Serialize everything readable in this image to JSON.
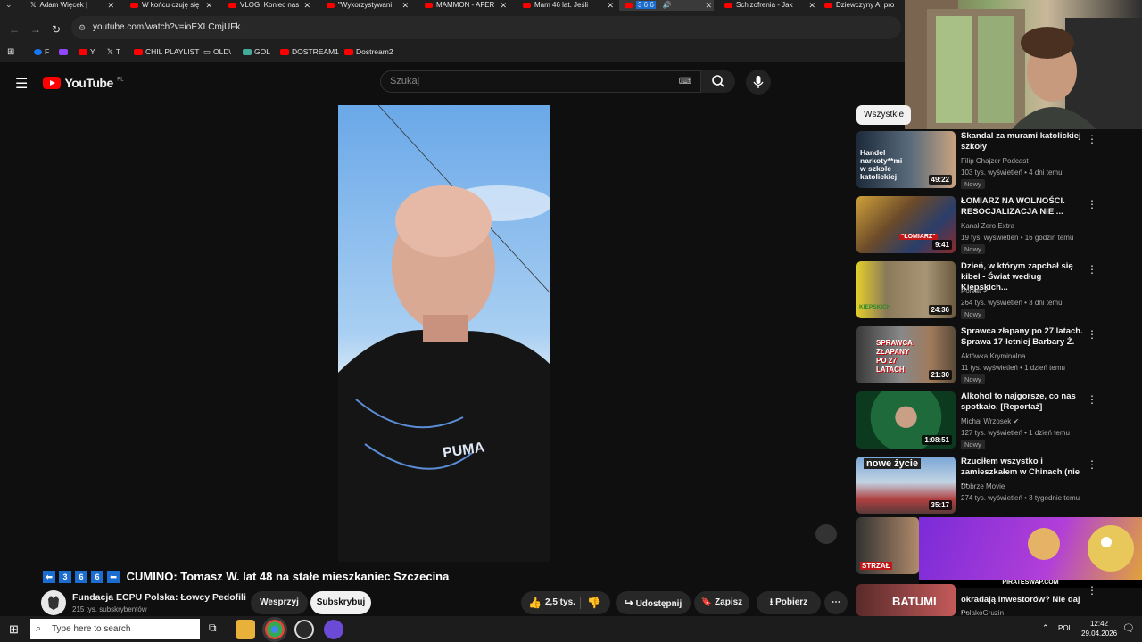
{
  "browser": {
    "tabs": [
      {
        "label": "Adam Więcek |"
      },
      {
        "label": "W końcu czuję się"
      },
      {
        "label": "VLOG: Koniec nas"
      },
      {
        "label": "\"Wykorzystywani"
      },
      {
        "label": "MAMMON - AFER"
      },
      {
        "label": "Mam 46 lat. Jeśli"
      },
      {
        "label": "3 6 6"
      },
      {
        "label": "Schizofrenia - Jak"
      },
      {
        "label": "Dziewczyny AI pro"
      }
    ],
    "url": "youtube.com/watch?v=ioEXLCmjUFk",
    "bookmarks": [
      "F",
      "Y",
      "T",
      "CHIL PLAYLIST",
      "OLD\\",
      "GOL",
      "DOSTREAM1",
      "Dostream2"
    ]
  },
  "youtube": {
    "logo_text": "YouTube",
    "logo_region": "PL",
    "search_placeholder": "Szukaj",
    "title_numbers": [
      "3",
      "6",
      "6"
    ],
    "video_title": "CUMINO: Tomasz W. lat 48 na stałe mieszkaniec Szczecina",
    "channel_name": "Fundacja ECPU Polska: Łowcy Pedofili",
    "subscribers": "215 tys. subskrybentów",
    "support_label": "Wesprzyj",
    "subscribe_label": "Subskrybuj",
    "likes": "2,5 tys.",
    "share_label": "Udostępnij",
    "save_label": "Zapisz",
    "download_label": "Pobierz",
    "filter_chip": "Wszystkie"
  },
  "recommendations": [
    {
      "title": "Skandal za murami katolickiej szkoły",
      "channel": "Filip Chajzer Podcast",
      "meta": "103 tys. wyświetleń • 4 dni temu",
      "badge": "Nowy",
      "duration": "49:22",
      "thumb_text": "Handel narkoty**mi w szkole katolickiej"
    },
    {
      "title": "ŁOMIARZ NA WOLNOŚCI. RESOCJALIZACJA NIE ...",
      "channel": "Kanał Zero Extra",
      "meta": "19 tys. wyświetleń • 16 godzin temu",
      "badge": "Nowy",
      "duration": "9:41",
      "thumb_text": "\"ŁOMIARZ\""
    },
    {
      "title": "Dzień, w którym zapchał się kibel - Świat według Kiepskich...",
      "channel": "Polsat",
      "meta": "264 tys. wyświetleń • 3 dni temu",
      "badge": "Nowy",
      "duration": "24:36",
      "thumb_text": "KIEPSKICH"
    },
    {
      "title": "Sprawca złapany po 27 latach. Sprawa 17-letniej Barbary Ż.",
      "channel": "Aktówka Kryminalna",
      "meta": "11 tys. wyświetleń • 1 dzień temu",
      "badge": "Nowy",
      "duration": "21:30",
      "thumb_text": "SPRAWCA ZŁAPANY PO 27 LATACH"
    },
    {
      "title": "Alkohol to najgorsze, co nas spotkało. [Reportaż]",
      "channel": "Michał Wrzosek",
      "meta": "127 tys. wyświetleń • 1 dzień temu",
      "badge": "Nowy",
      "duration": "1:08:51",
      "thumb_text": ""
    },
    {
      "title": "Rzuciłem wszystko i zamieszkałem w Chinach (nie ...",
      "channel": "Dobrze Movie",
      "meta": "274 tys. wyświetleń • 3 tygodnie temu",
      "badge": "",
      "duration": "35:17",
      "thumb_text": "nowe życie"
    }
  ],
  "partial_recs": [
    {
      "title": "okradają inwestorów? Nie daj ...",
      "channel": "PolakoGruzin",
      "thumb_text": "BATUMI"
    }
  ],
  "ad": {
    "label": "PIRATESWAP.COM",
    "thumb_text": "STRZAŁ"
  },
  "taskbar": {
    "search_placeholder": "Type here to search",
    "language": "POL",
    "time": "12:42",
    "date": "29.04.2026"
  },
  "colors": {
    "brand": "#ff0000",
    "background": "#0f0f0f",
    "chip": "#272727"
  }
}
